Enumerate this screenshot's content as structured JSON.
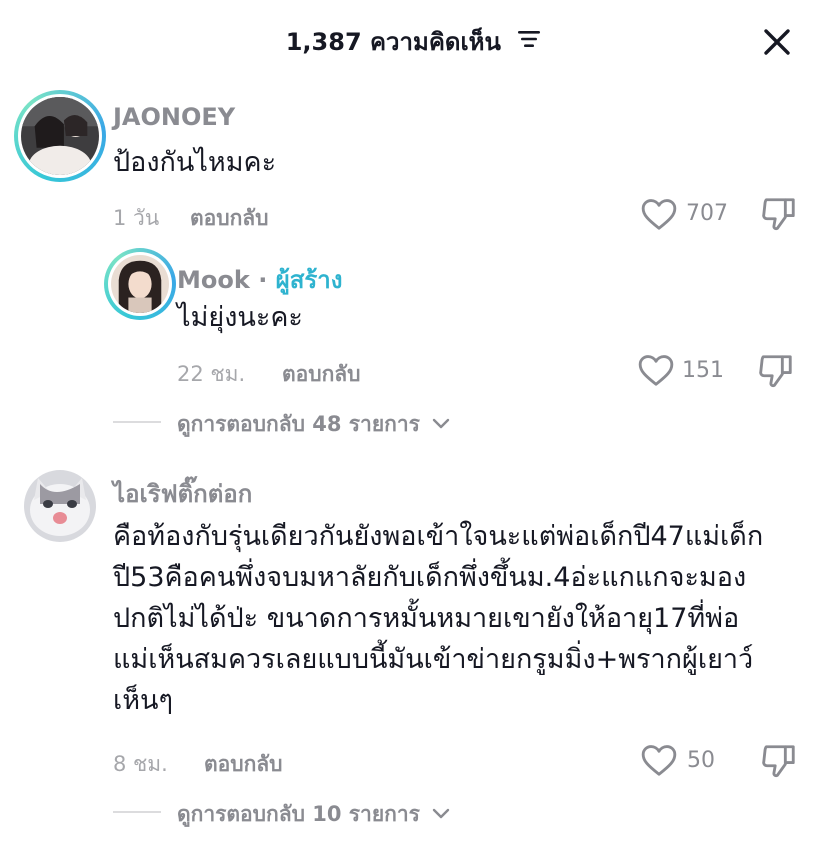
{
  "header": {
    "title": "1,387 ความคิดเห็น",
    "filter_icon": "sort-icon",
    "close_icon": "close-icon"
  },
  "comments": [
    {
      "username": "JAONOEY",
      "text": "ป้องกันไหมคะ",
      "time": "1 วัน",
      "reply_label": "ตอบกลับ",
      "likes": "707",
      "replies": [
        {
          "username": "Mook",
          "separator": "·",
          "badge": "ผู้สร้าง",
          "text": "ไม่ยุ่งนะคะ",
          "time": "22 ชม.",
          "reply_label": "ตอบกลับ",
          "likes": "151"
        }
      ],
      "view_replies": "ดูการตอบกลับ 48 รายการ"
    },
    {
      "username": "ไอเริฟติ๊กต่อก",
      "text_lines": [
        "คือท้องกับรุ่นเดียวกันยังพอเข้าใจนะแต่พ่อเด็กปี47แม่เด็ก",
        "ปี53คือคนพึ่งจบมหาลัยกับเด็กพึ่งขึ้นม.4อ่ะแกแกจะมอง",
        "ปกติไม่ได้ป่ะ ขนาดการหมั้นหมายเขายังให้อายุ17ที่พ่อ",
        "แม่เห็นสมควรเลยแบบนี้มันเข้าข่ายกรูมมิ่ง+พรากผู้เยาว์",
        "เห็นๆ"
      ],
      "time": "8 ชม.",
      "reply_label": "ตอบกลับ",
      "likes": "50",
      "view_replies": "ดูการตอบกลับ 10 รายการ"
    }
  ],
  "colors": {
    "text": "#161823",
    "muted": "#8a8b91",
    "creator": "#2eb3cf",
    "ring": "#36c7d7"
  }
}
